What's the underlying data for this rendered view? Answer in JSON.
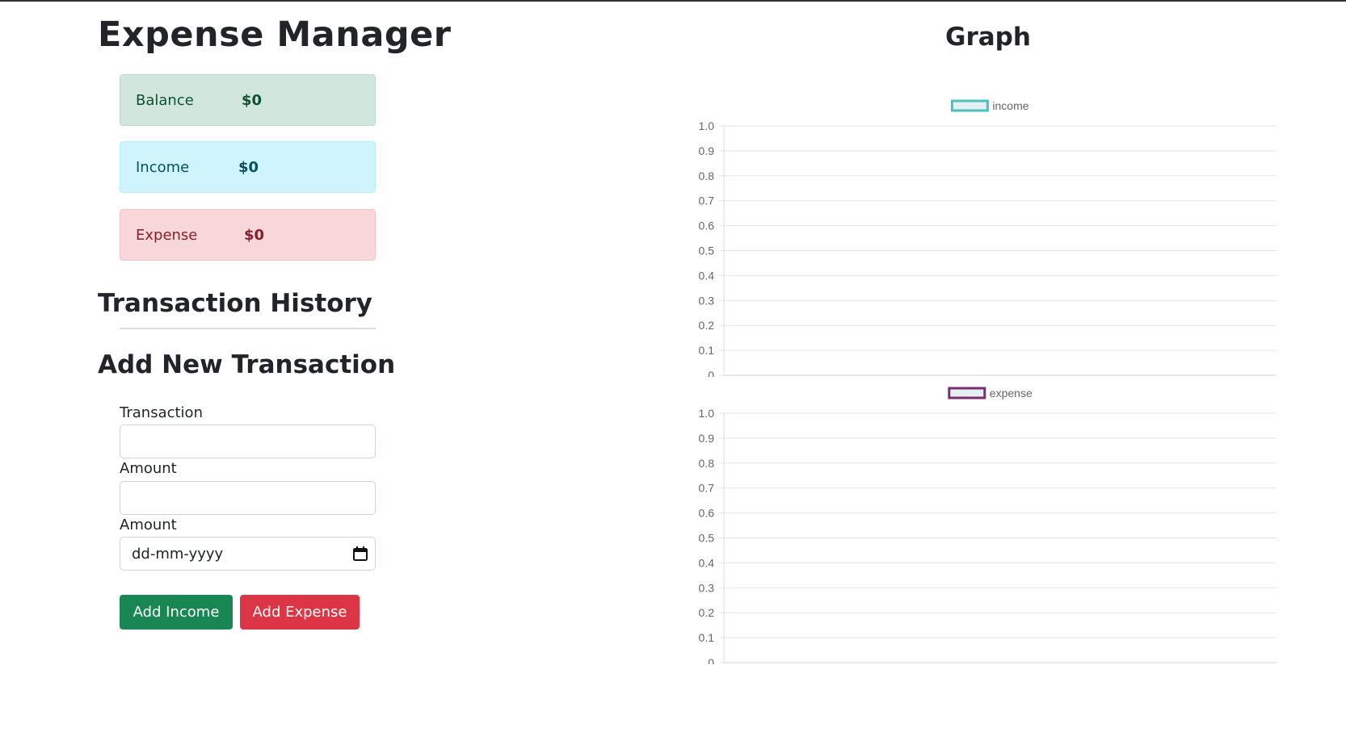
{
  "app": {
    "title": "Expense Manager"
  },
  "summary": {
    "balance": {
      "label": "Balance",
      "value": "$0"
    },
    "income": {
      "label": "Income",
      "value": "$0"
    },
    "expense": {
      "label": "Expense",
      "value": "$0"
    }
  },
  "history": {
    "title": "Transaction History",
    "items": []
  },
  "form": {
    "title": "Add New Transaction",
    "transaction_label": "Transaction",
    "transaction_value": "",
    "amount_label": "Amount",
    "amount_value": "",
    "date_label": "Amount",
    "date_placeholder": "dd-mm-yyyy",
    "add_income_label": "Add Income",
    "add_expense_label": "Add Expense"
  },
  "graph": {
    "title": "Graph"
  },
  "colors": {
    "income_series": "#4bc0c0",
    "expense_series": "#7b2d73"
  },
  "chart_data": [
    {
      "type": "bar",
      "categories": [],
      "series": [
        {
          "name": "income",
          "values": []
        }
      ],
      "ylim": [
        0,
        1.0
      ],
      "yticks": [
        "1.0",
        "0.9",
        "0.8",
        "0.7",
        "0.6",
        "0.5",
        "0.4",
        "0.3",
        "0.2",
        "0.1",
        "0"
      ],
      "grid": true,
      "legend": "top-center"
    },
    {
      "type": "bar",
      "categories": [],
      "series": [
        {
          "name": "expense",
          "values": []
        }
      ],
      "ylim": [
        0,
        1.0
      ],
      "yticks": [
        "1.0",
        "0.9",
        "0.8",
        "0.7",
        "0.6",
        "0.5",
        "0.4",
        "0.3",
        "0.2",
        "0.1",
        "0"
      ],
      "grid": true,
      "legend": "top-center"
    }
  ]
}
